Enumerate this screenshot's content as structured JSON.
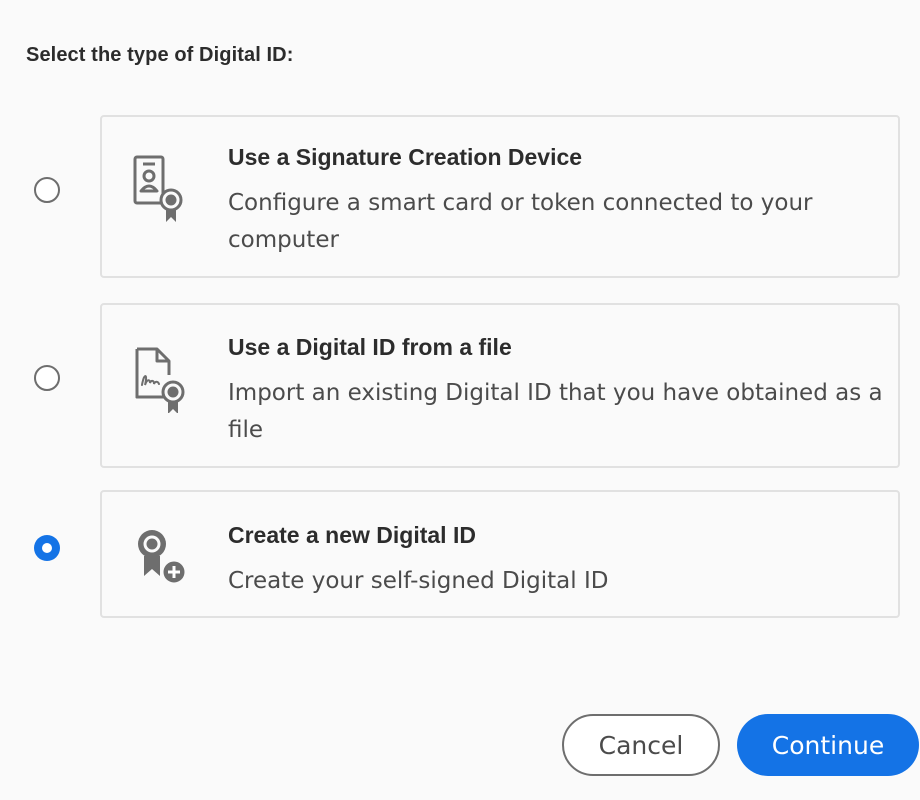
{
  "dialog": {
    "heading": "Select the type of Digital ID:"
  },
  "options": [
    {
      "title": "Use a Signature Creation Device",
      "description": "Configure a smart card or token connected to your computer",
      "icon": "signature-device-icon",
      "selected": false
    },
    {
      "title": "Use a Digital ID from a file",
      "description": "Import an existing Digital ID that you have obtained as a file",
      "icon": "certificate-file-icon",
      "selected": false
    },
    {
      "title": "Create a new Digital ID",
      "description": "Create your self-signed Digital ID",
      "icon": "create-digital-id-icon",
      "selected": true
    }
  ],
  "buttons": {
    "cancel": "Cancel",
    "continue": "Continue"
  },
  "colors": {
    "accent": "#1473e6",
    "icon": "#6e6e6e",
    "border": "#e1e1e1"
  }
}
